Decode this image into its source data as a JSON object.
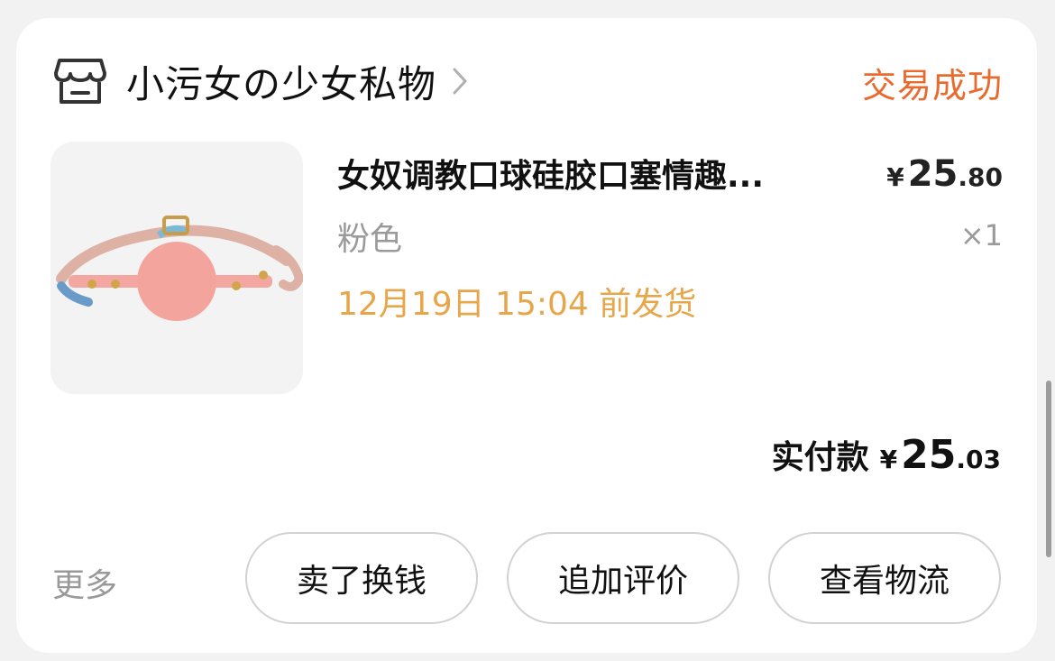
{
  "shop": {
    "name": "小污女の少女私物",
    "icon": "store-icon"
  },
  "order": {
    "status": "交易成功"
  },
  "item": {
    "title": "女奴调教口球硅胶口塞情趣...",
    "price_symbol": "¥",
    "price_int": "25",
    "price_dec": ".80",
    "variant": "粉色",
    "quantity": "×1",
    "ship_note": "12月19日 15:04 前发货"
  },
  "payment": {
    "label": "实付款",
    "symbol": "¥",
    "int": "25",
    "dec": ".03"
  },
  "actions": {
    "more": "更多",
    "sell": "卖了换钱",
    "review": "追加评价",
    "logistics": "查看物流"
  },
  "colors": {
    "status": "#e96a2e",
    "ship_note": "#e7a649",
    "background": "#f2f2f2"
  }
}
